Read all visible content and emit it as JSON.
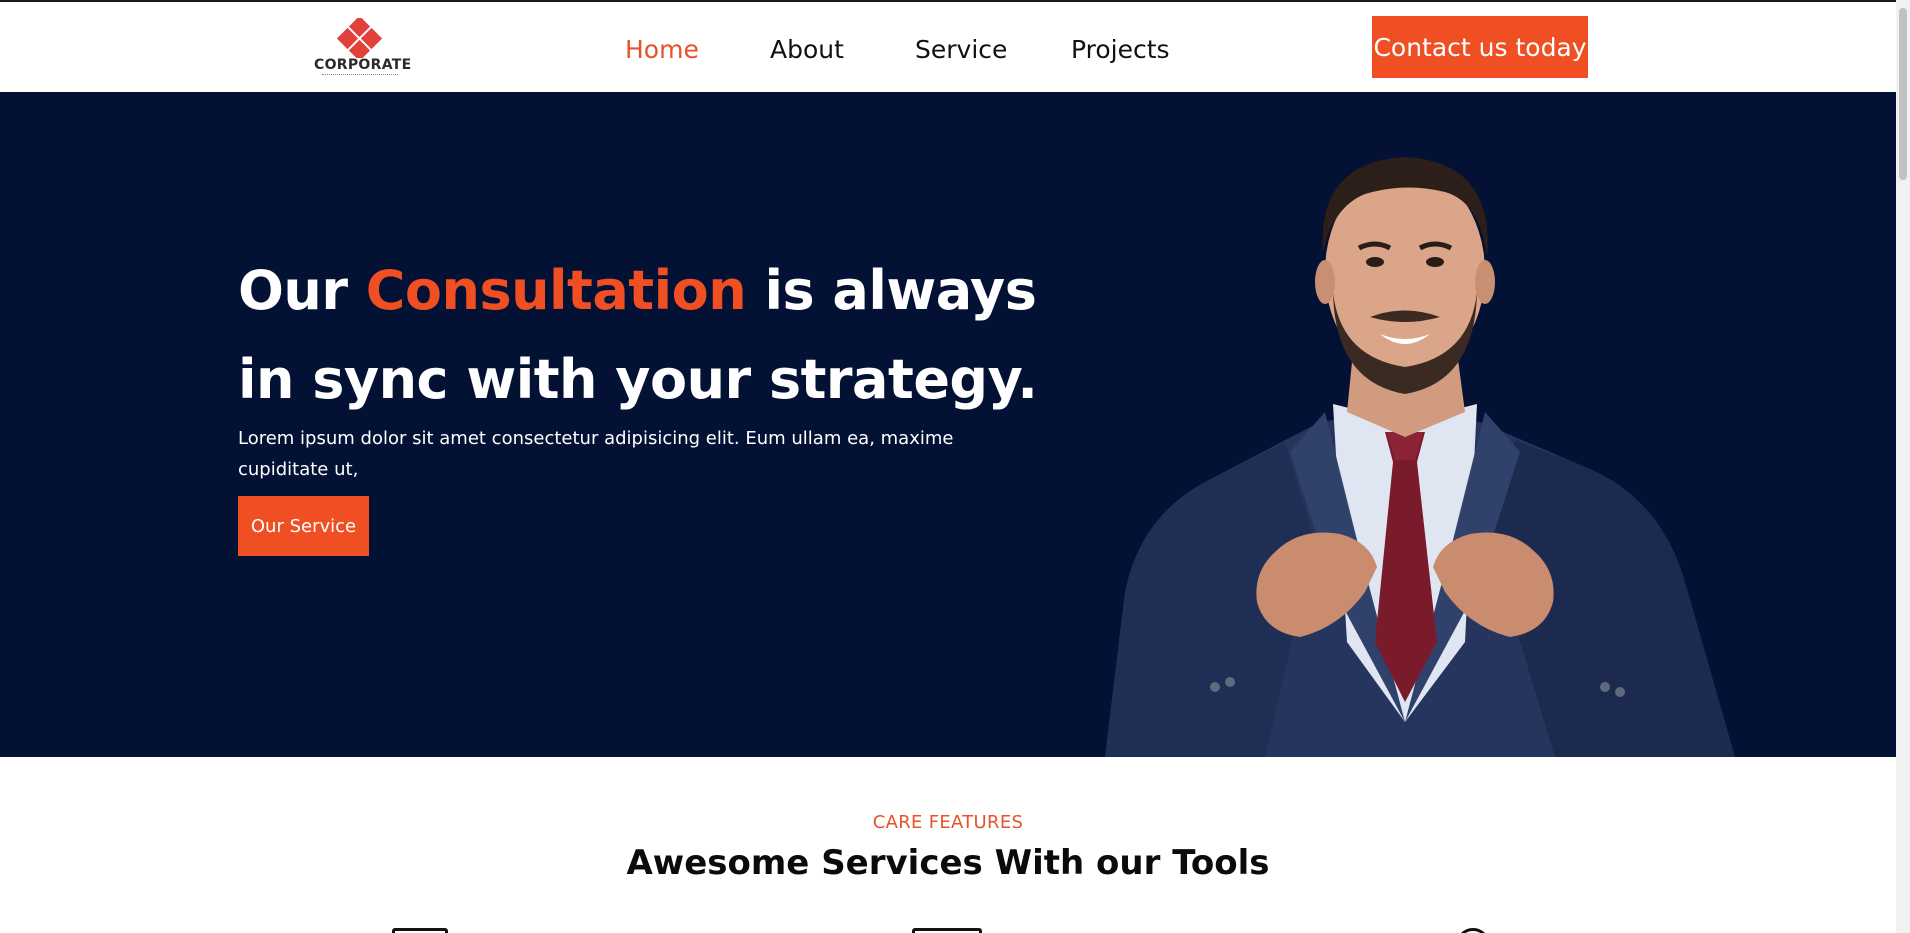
{
  "brand": {
    "name": "CORPORATE",
    "accent_color": "#f04e23",
    "navy_color": "#031135"
  },
  "nav": {
    "items": [
      {
        "label": "Home",
        "active": true
      },
      {
        "label": "About",
        "active": false
      },
      {
        "label": "Service",
        "active": false
      },
      {
        "label": "Projects",
        "active": false
      }
    ],
    "cta_label": "Contact us today"
  },
  "hero": {
    "title_before": "Our ",
    "title_accent": "Consultation",
    "title_after_line1": " is always",
    "title_line2": "in sync with your strategy.",
    "text": "Lorem ipsum dolor sit amet consectetur adipisicing elit. Eum ullam ea, maxime cupiditate ut,",
    "button_label": "Our Service",
    "image": "businessman-in-suit-photo"
  },
  "features": {
    "eyebrow": "CARE FEATURES",
    "title": "Awesome Services With our Tools",
    "icons": [
      "service-icon-1",
      "service-icon-2",
      "service-icon-3"
    ]
  }
}
